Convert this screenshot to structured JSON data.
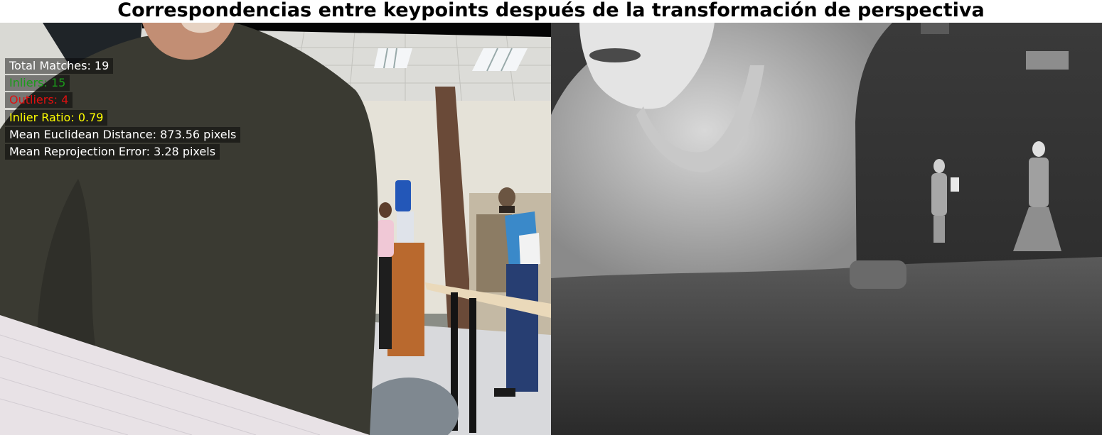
{
  "title": "Correspondencias entre keypoints después de la transformación de perspectiva",
  "stats": {
    "total_matches": "Total Matches: 19",
    "inliers": "Inliers: 15",
    "outliers": "Outliers: 4",
    "inlier_ratio": "Inlier Ratio: 0.79",
    "mean_euclidean": "Mean Euclidean Distance: 873.56 pixels",
    "mean_reprojection": "Mean Reprojection Error: 3.28 pixels"
  },
  "colors": {
    "total_matches": "#ffffff",
    "inliers": "#1a9a1a",
    "outliers": "#e01010",
    "inlier_ratio": "#ffff00",
    "mean_euclidean": "#ffffff",
    "mean_reprojection": "#ffffff"
  }
}
